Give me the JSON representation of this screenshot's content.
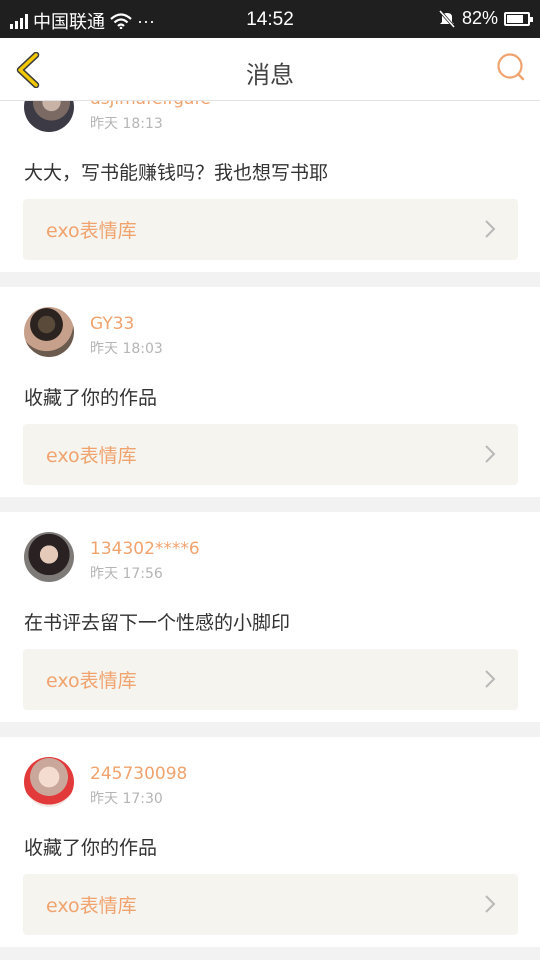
{
  "status_bar": {
    "carrier": "中国联通",
    "more": "···",
    "time": "14:52",
    "battery": "82%",
    "battery_level": 0.82
  },
  "header": {
    "title": "消息"
  },
  "colors": {
    "accent": "#f0a36e",
    "link_bg": "#f5f4ee",
    "page_bg": "#f2f2f2"
  },
  "messages": [
    {
      "username": "dsjlmafelfgafe",
      "time": "昨天 18:13",
      "content": "大大，写书能赚钱吗？我也想写书耶",
      "link": "exo表情库"
    },
    {
      "username": "GY33",
      "time": "昨天 18:03",
      "content": "收藏了你的作品",
      "link": "exo表情库"
    },
    {
      "username": "134302****6",
      "time": "昨天 17:56",
      "content": "在书评去留下一个性感的小脚印",
      "link": "exo表情库"
    },
    {
      "username": "245730098",
      "time": "昨天 17:30",
      "content": "收藏了你的作品",
      "link": "exo表情库"
    }
  ]
}
